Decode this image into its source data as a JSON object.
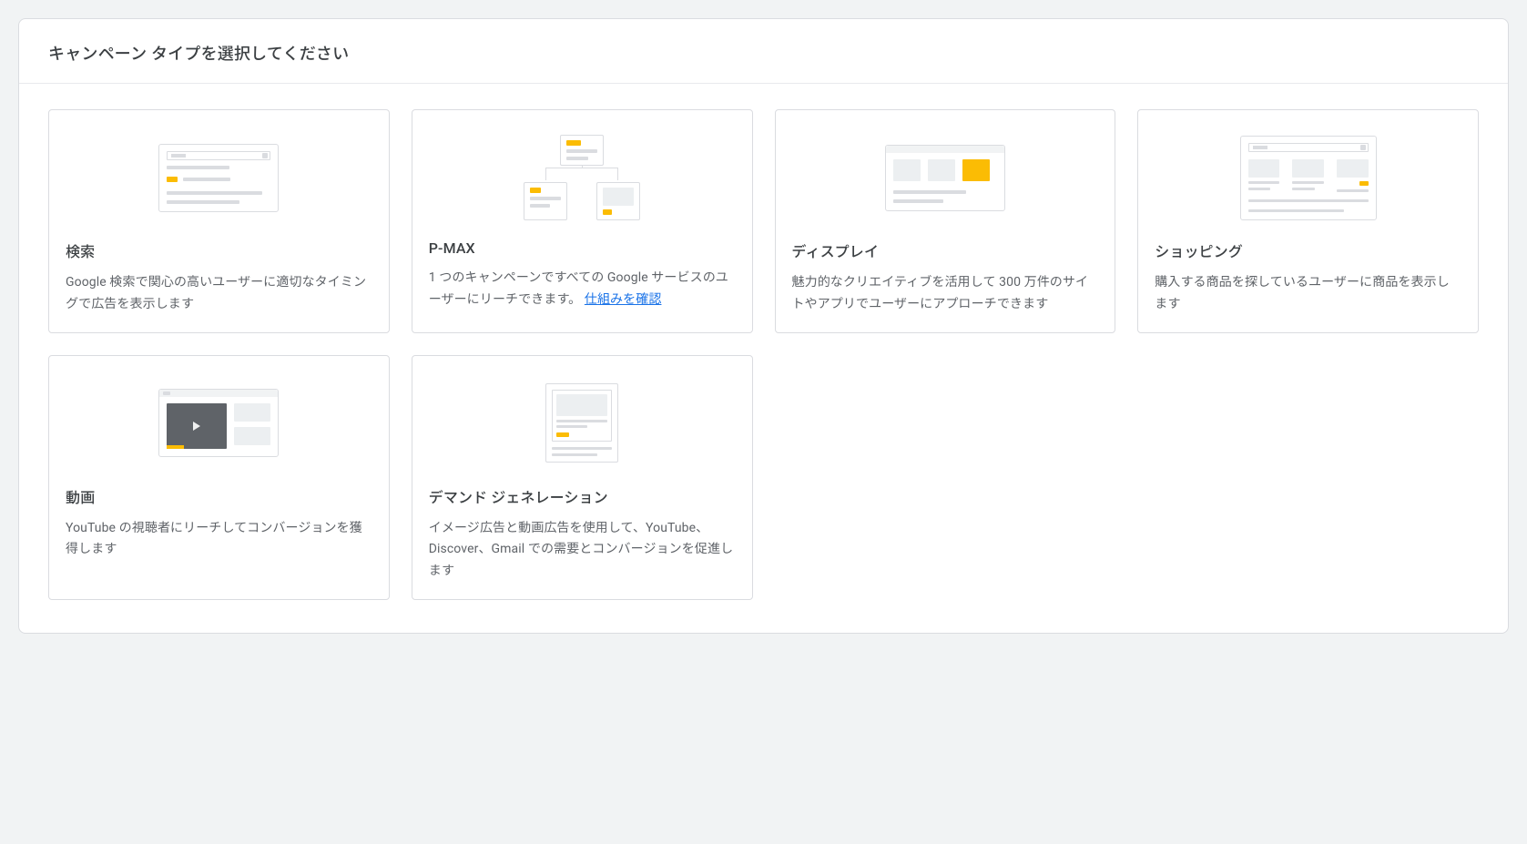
{
  "header": {
    "title": "キャンペーン タイプを選択してください"
  },
  "cards": {
    "search": {
      "title": "検索",
      "desc": "Google 検索で関心の高いユーザーに適切なタイミングで広告を表示します"
    },
    "pmax": {
      "title": "P-MAX",
      "desc_prefix": "1 つのキャンペーンですべての Google サービスのユーザーにリーチできます。 ",
      "learn_link": "仕組みを確認"
    },
    "display": {
      "title": "ディスプレイ",
      "desc": "魅力的なクリエイティブを活用して 300 万件のサイトやアプリでユーザーにアプローチできます"
    },
    "shopping": {
      "title": "ショッピング",
      "desc": "購入する商品を探しているユーザーに商品を表示します"
    },
    "video": {
      "title": "動画",
      "desc": "YouTube の視聴者にリーチしてコンバージョンを獲得します"
    },
    "demand": {
      "title": "デマンド ジェネレーション",
      "desc": "イメージ広告と動画広告を使用して、YouTube、Discover、Gmail での需要とコンバージョンを促進します"
    }
  }
}
